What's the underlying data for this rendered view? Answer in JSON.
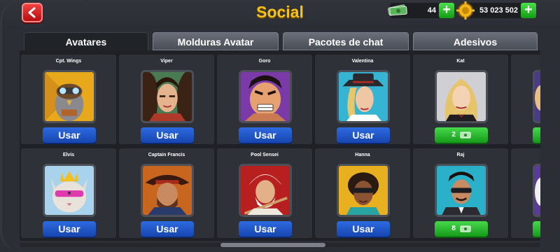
{
  "header": {
    "title": "Social",
    "cash_amount": "44",
    "coins_amount": "53 023 502",
    "plus_label": "+"
  },
  "tabs": [
    {
      "label": "Avatares",
      "active": true
    },
    {
      "label": "Molduras Avatar",
      "active": false
    },
    {
      "label": "Pacotes de chat",
      "active": false
    },
    {
      "label": "Adesivos",
      "active": false
    }
  ],
  "avatars": [
    {
      "name": "Cpt. Wings",
      "action": "Usar"
    },
    {
      "name": "Viper",
      "action": "Usar"
    },
    {
      "name": "Goro",
      "action": "Usar"
    },
    {
      "name": "Valentina",
      "action": "Usar"
    },
    {
      "name": "Kat",
      "price": "2"
    },
    {
      "name": "Elvis",
      "action": "Usar"
    },
    {
      "name": "Captain Francis",
      "action": "Usar"
    },
    {
      "name": "Pool Sensei",
      "action": "Usar"
    },
    {
      "name": "Hanna",
      "action": "Usar"
    },
    {
      "name": "Raj",
      "price": "8"
    }
  ],
  "colors": {
    "accent_title": "#f6c31a",
    "use_button": "#2e6ae0",
    "buy_button": "#46d84a",
    "back_button": "#e02a2a"
  }
}
